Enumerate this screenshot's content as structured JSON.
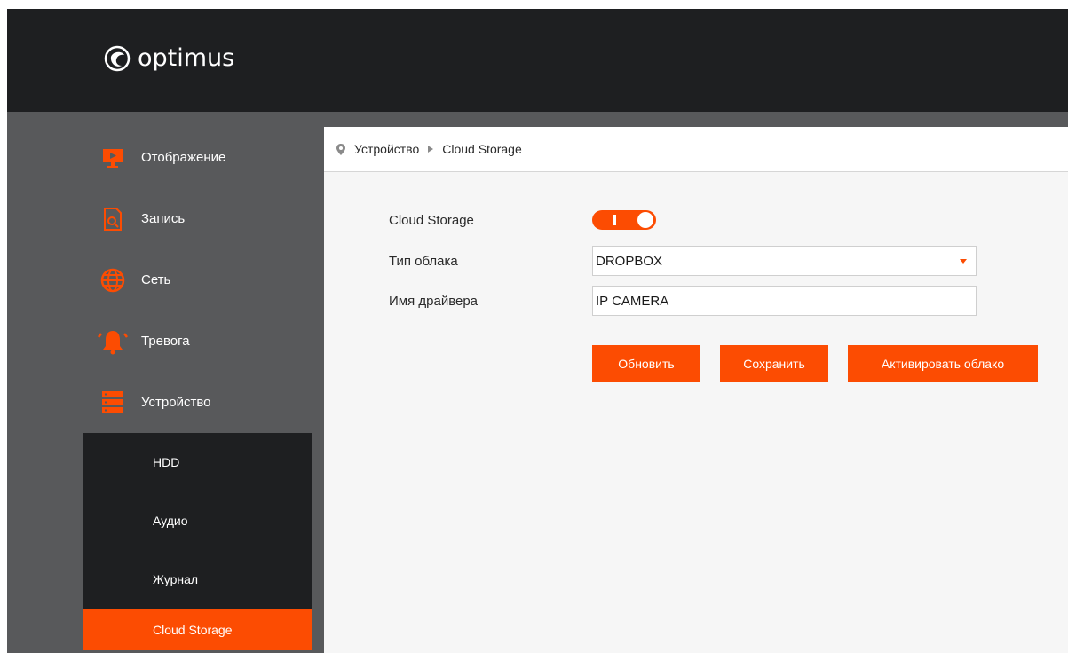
{
  "header": {
    "brand": "optimus"
  },
  "sidebar": {
    "items": [
      {
        "label": "Отображение",
        "icon": "monitor-icon"
      },
      {
        "label": "Запись",
        "icon": "record-search-icon"
      },
      {
        "label": "Сеть",
        "icon": "globe-icon"
      },
      {
        "label": "Тревога",
        "icon": "alarm-bell-icon"
      },
      {
        "label": "Устройство",
        "icon": "server-icon"
      }
    ],
    "sub_items": [
      {
        "label": "HDD"
      },
      {
        "label": "Аудио"
      },
      {
        "label": "Журнал"
      },
      {
        "label": "Cloud Storage",
        "active": true
      }
    ]
  },
  "breadcrumb": {
    "parent": "Устройство",
    "current": "Cloud Storage"
  },
  "form": {
    "cloud_storage": {
      "label": "Cloud Storage",
      "enabled": true
    },
    "cloud_type": {
      "label": "Тип облака",
      "value": "DROPBOX"
    },
    "driver_name": {
      "label": "Имя драйвера",
      "value": "IP CAMERA"
    }
  },
  "buttons": {
    "refresh": "Обновить",
    "save": "Сохранить",
    "activate": "Активировать облако"
  },
  "colors": {
    "accent": "#fc4c02",
    "header_bg": "#1e1f21",
    "sidebar_bg": "#58595b"
  }
}
